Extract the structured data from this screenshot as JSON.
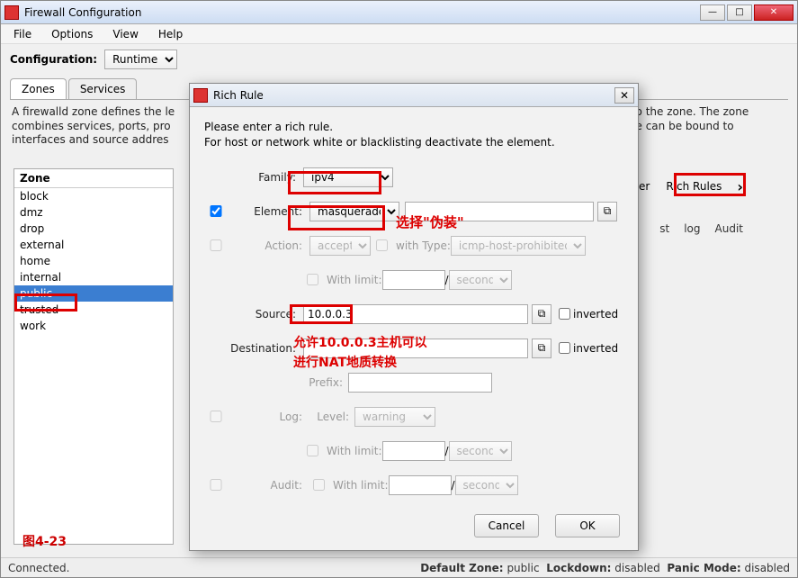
{
  "main": {
    "title": "Firewall Configuration",
    "menu": {
      "file": "File",
      "options": "Options",
      "view": "View",
      "help": "Help"
    },
    "config_label": "Configuration:",
    "config_value": "Runtime",
    "tabs": {
      "zones": "Zones",
      "services": "Services"
    },
    "desc_part1": "A firewalld zone defines the le",
    "desc_part2": "to the zone. The zone",
    "desc_part3": "combines services, ports, pro",
    "desc_part4": "zone can be bound to",
    "desc_part5": "interfaces and source addres",
    "zone_header": "Zone",
    "zones": [
      "block",
      "dmz",
      "drop",
      "external",
      "home",
      "internal",
      "public",
      "trusted",
      "work"
    ],
    "rtab_filter": "Filter",
    "rtab_rich": "Rich Rules",
    "subhead": {
      "st": "st",
      "log": "log",
      "audit": "Audit"
    },
    "status_left": "Connected.",
    "status_def_lbl": "Default Zone:",
    "status_def_val": "public",
    "status_lock_lbl": "Lockdown:",
    "status_lock_val": "disabled",
    "status_panic_lbl": "Panic Mode:",
    "status_panic_val": "disabled",
    "fig_label": "图4-23"
  },
  "dlg": {
    "title": "Rich Rule",
    "intro1": "Please enter a rich rule.",
    "intro2": "For host or network white or blacklisting deactivate the element.",
    "lbl_family": "Family:",
    "family": "ipv4",
    "lbl_element": "Element:",
    "element": "masquerade",
    "lbl_action": "Action:",
    "action_val": "accept",
    "withtype_lbl": "with Type:",
    "withtype_val": "icmp-host-prohibited",
    "withlimit_lbl": "With limit:",
    "unit_second": "second",
    "lbl_source": "Source:",
    "source": "10.0.0.3",
    "inverted": "inverted",
    "lbl_dest": "Destination:",
    "dest": "",
    "lbl_prefix": "Prefix:",
    "lbl_log": "Log:",
    "lbl_level": "Level:",
    "level_val": "warning",
    "lbl_audit": "Audit:",
    "btn_cancel": "Cancel",
    "btn_ok": "OK"
  },
  "ann": {
    "elem_note": "选择\"伪装\"",
    "src_note1": "允许10.0.0.3主机可以",
    "src_note2": "进行NAT地质转换"
  }
}
